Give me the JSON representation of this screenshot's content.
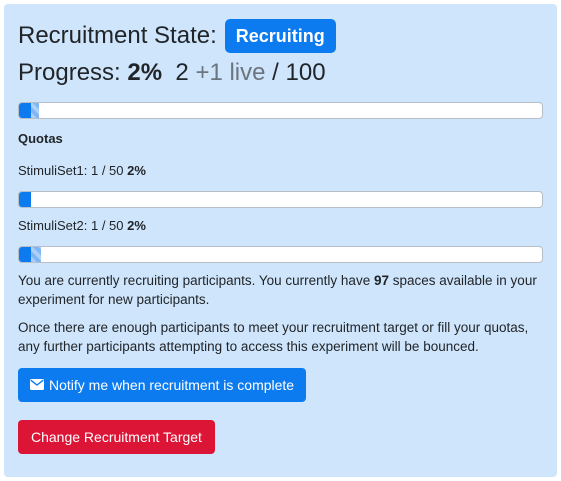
{
  "header": {
    "title": "Recruitment State:",
    "state_badge": "Recruiting"
  },
  "progress": {
    "label": "Progress:",
    "percent_text": "2%",
    "count": "2",
    "live_text": "+1 live",
    "separator_total": "/ 100",
    "fraction": 0.02,
    "live_fraction": 0.01
  },
  "quotas": {
    "heading": "Quotas",
    "items": [
      {
        "label": "StimuliSet1: 1 / 50",
        "percent_text": "2%",
        "fraction": 0.02,
        "live_fraction": 0.0
      },
      {
        "label": "StimuliSet2: 1 / 50",
        "percent_text": "2%",
        "fraction": 0.02,
        "live_fraction": 0.02
      }
    ]
  },
  "info": {
    "p1_before": "You are currently recruiting participants. You currently have ",
    "p1_count": "97",
    "p1_after": " spaces available in your experiment for new participants.",
    "p2": "Once there are enough participants to meet your recruitment target or fill your quotas, any further participants attempting to access this experiment will be bounced."
  },
  "buttons": {
    "notify_label": "Notify me when recruitment is complete",
    "notify_icon": "envelope-icon",
    "change_target_label": "Change Recruitment Target"
  },
  "colors": {
    "primary": "#0d7bf0",
    "danger": "#dc1537",
    "panel_bg": "#cfe5fb",
    "muted": "#6c757d"
  }
}
